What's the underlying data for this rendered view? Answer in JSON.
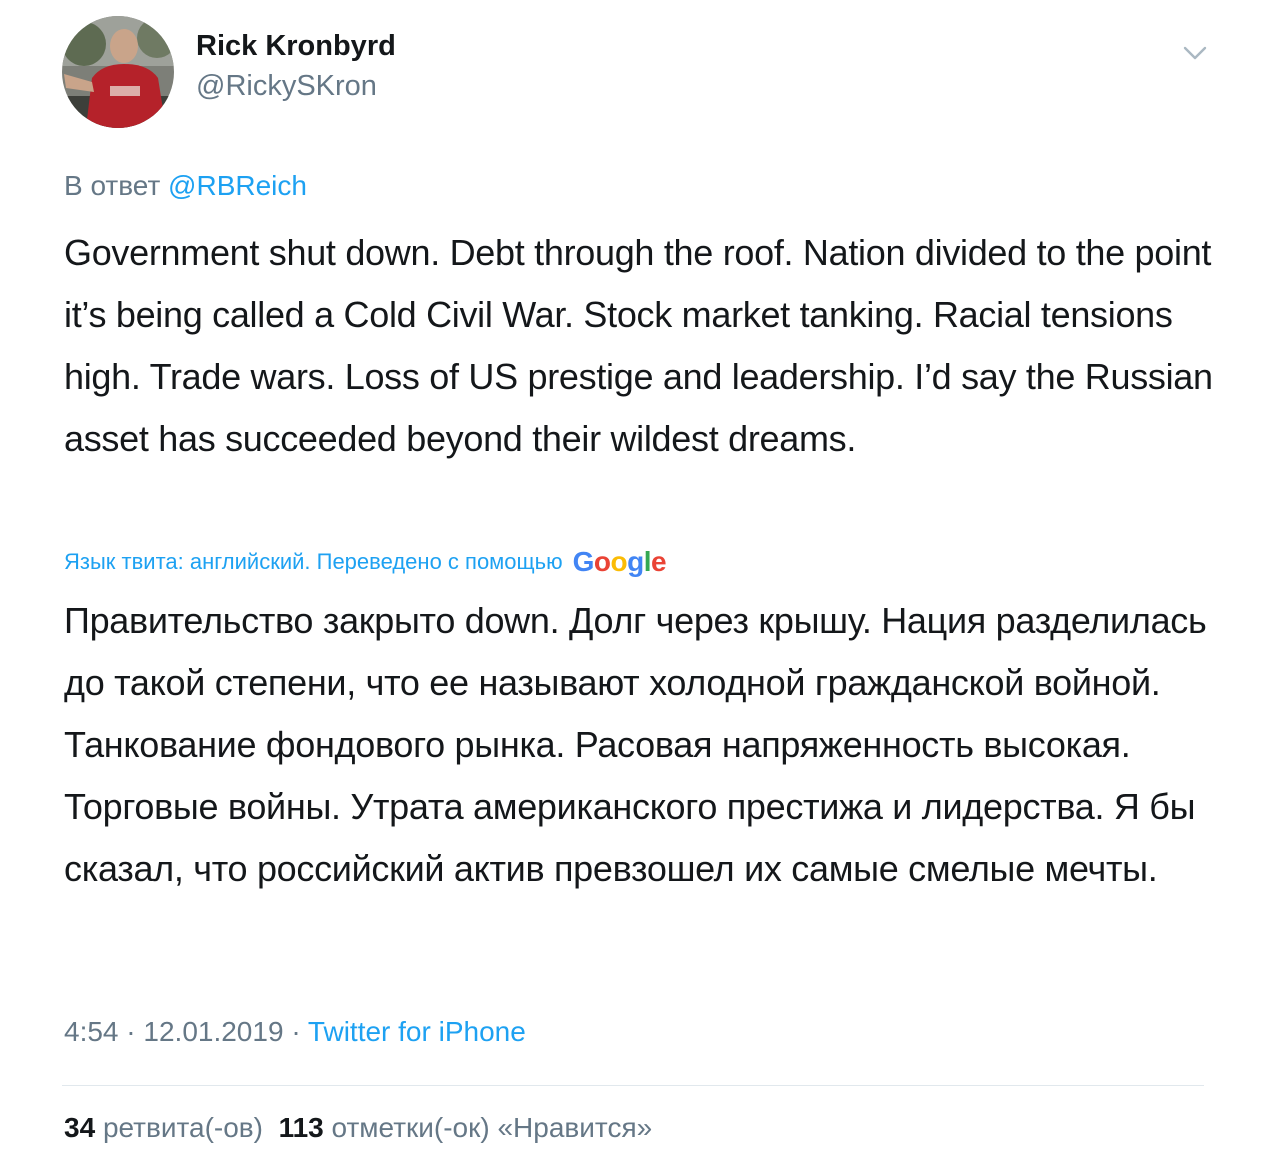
{
  "tweet": {
    "author": {
      "display_name": "Rick Kronbyrd",
      "handle": "@RickySKron",
      "avatar_icon": "user-photo-avatar"
    },
    "menu_icon": "chevron-down-icon",
    "reply": {
      "prefix": "В ответ",
      "mention": "@RBReich"
    },
    "text": "Government shut down. Debt through the roof. Nation divided to the point it’s being called a Cold Civil War. Stock market tanking. Racial tensions high. Trade wars. Loss of US prestige and leadership. I’d say the Russian asset has succeeded beyond their wildest dreams.",
    "translation": {
      "label": "Язык твита: английский. Переведено с помощью",
      "provider": "Google",
      "text": "Правительство закрыто down. Долг через крышу. Нация разделилась до такой степени, что ее называют холодной гражданской войной. Танкование фондового рынка. Расовая напряженность высокая. Торговые войны. Утрата американского престижа и лидерства. Я бы сказал, что российский актив превзошел их самые смелые мечты."
    },
    "meta": {
      "time": "4:54",
      "separator": "·",
      "date": "12.01.2019",
      "source": "Twitter for iPhone"
    },
    "stats": {
      "retweets_count": "34",
      "retweets_label": "ретвита(-ов)",
      "likes_count": "113",
      "likes_label": "отметки(-ок) «Нравится»"
    }
  },
  "colors": {
    "text": "#14171a",
    "secondary": "#657786",
    "link": "#1da1f2",
    "divider": "#e1e8ed"
  }
}
